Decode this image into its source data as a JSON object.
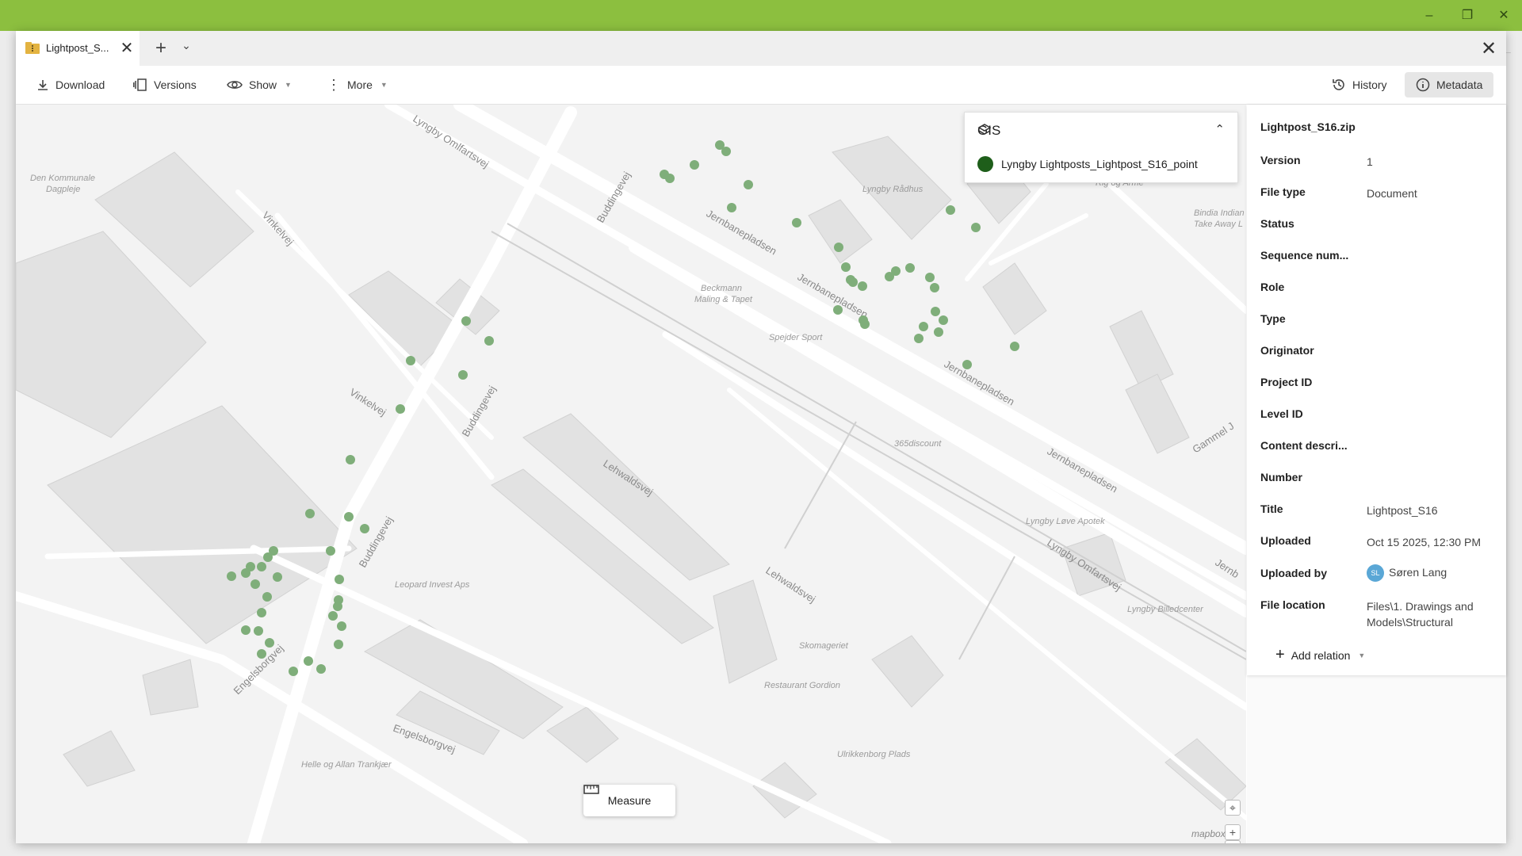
{
  "tab": {
    "title": "Lightpost_S..."
  },
  "toolbar": {
    "download": "Download",
    "versions": "Versions",
    "show": "Show",
    "more": "More",
    "history": "History",
    "metadata": "Metadata"
  },
  "gis": {
    "title": "GIS",
    "layer_label": "Lyngby Lightposts_Lightpost_S16_point",
    "layer_color": "#1e5e1a"
  },
  "map": {
    "streets": [
      "Lyngby Omlfartsvej",
      "Buddingevej",
      "Buddingevej",
      "Buddingevej",
      "Vinkelvej",
      "Vinkelvej",
      "Jernbanepladsen",
      "Jernbanepladsen",
      "Jernbanepladsen",
      "Jernbanepladsen",
      "Lehwaldsvej",
      "Lehwaldsvej",
      "Engelsborgvej",
      "Engelsborgvej",
      "Lyngby Omfartsvej",
      "Gammel J",
      "Jernb"
    ],
    "places": [
      "Den Kommunale",
      "Dagpleje",
      "Lyngby Rådhus",
      "Rig og Arme",
      "Bindia Indian",
      "Take Away L",
      "Beckmann",
      "Maling & Tapet",
      "Spejder Sport",
      "365discount",
      "Lyngby Løve Apotek",
      "Lyngby Billedcenter",
      "Leopard Invest Aps",
      "Skomageriet",
      "Restaurant Gordion",
      "Ulrikkenborg Plads",
      "Helle og Allan Trankjær"
    ],
    "point_color": "#7fae7a",
    "attribution": "mapbox"
  },
  "measure": {
    "label": "Measure"
  },
  "metadata": {
    "filename": "Lightpost_S16.zip",
    "rows": [
      {
        "label": "Version",
        "value": "1"
      },
      {
        "label": "File type",
        "value": "Document"
      },
      {
        "label": "Status",
        "value": ""
      },
      {
        "label": "Sequence num...",
        "value": ""
      },
      {
        "label": "Role",
        "value": ""
      },
      {
        "label": "Type",
        "value": ""
      },
      {
        "label": "Originator",
        "value": ""
      },
      {
        "label": "Project ID",
        "value": ""
      },
      {
        "label": "Level ID",
        "value": ""
      },
      {
        "label": "Content descri...",
        "value": ""
      },
      {
        "label": "Number",
        "value": ""
      },
      {
        "label": "Title",
        "value": "Lightpost_S16"
      },
      {
        "label": "Uploaded",
        "value": "Oct 15 2025, 12:30 PM"
      },
      {
        "label": "Uploaded by",
        "value": "Søren Lang",
        "initials": "SL"
      },
      {
        "label": "File location",
        "value": "Files\\1. Drawings and Models\\Structural"
      }
    ],
    "add_relation": "Add relation"
  }
}
